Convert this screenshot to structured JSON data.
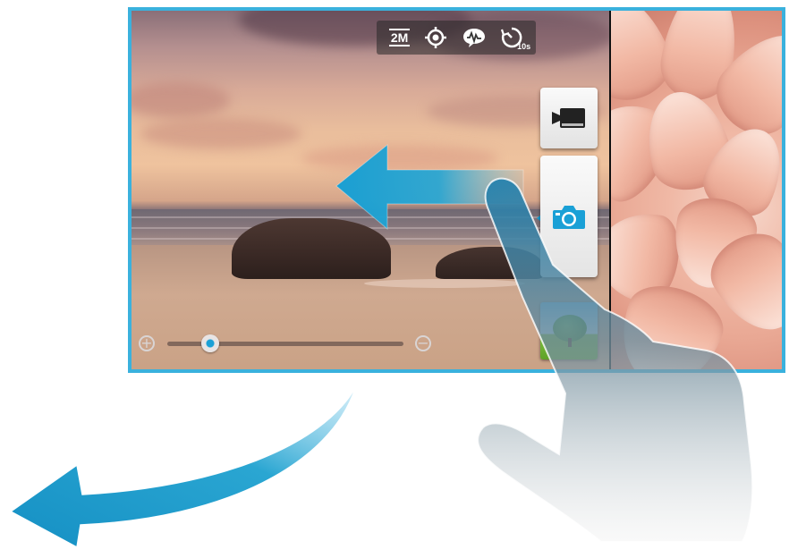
{
  "camera": {
    "status_bar": {
      "resolution_label": "2M",
      "focus_icon": "focus-target-icon",
      "white_balance_icon": "auto-scene-icon",
      "timer_icon": "self-timer-icon",
      "timer_label": "10s"
    },
    "zoom": {
      "level": 0.18,
      "plus_icon": "zoom-in-icon",
      "minus_icon": "zoom-out-icon"
    },
    "mode_buttons": {
      "video_icon": "video-camera-icon",
      "camera_icon": "camera-icon",
      "active_mode": "camera"
    },
    "thumbnail_icon": "last-photo-thumbnail"
  },
  "gesture": {
    "direction": "left",
    "swipe_arrow_icon": "swipe-left-arrow",
    "curved_arrow_icon": "curved-left-arrow",
    "hand_icon": "pointing-hand"
  },
  "colors": {
    "frame": "#3ab1dd",
    "accent": "#1aa0d6",
    "arrow": "#2aa6d2"
  }
}
